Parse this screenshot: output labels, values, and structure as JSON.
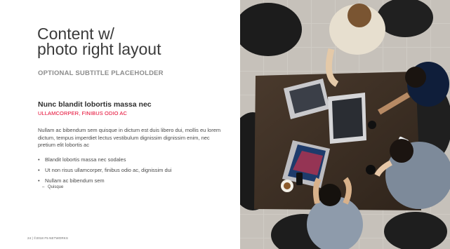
{
  "title": "Content w/\nphoto right layout",
  "subtitle": "OPTIONAL SUBTITLE PLACEHOLDER",
  "heading": "Nunc blandit lobortis massa nec",
  "subheading": "ULLAMCORPER, FINIBUS ODIO AC",
  "paragraph": "Nullam ac bibendum sem quisque in dictum est duis libero dui, mollis eu lorem dictum, tempus imperdiet lectus vestibulum dignissim dignissim enim, nec pretium elit lobortis ac",
  "bullets": [
    {
      "text": "Blandit lobortis massa nec sodales"
    },
    {
      "text": "Ut non risus ullamcorper, finibus odio ac, dignissim dui"
    },
    {
      "text": "Nullam ac bibendum sem"
    }
  ],
  "sub_bullet": "Quisque",
  "bullet_char": "•",
  "sub_bullet_char": "–",
  "footer": "24 | ©2018 F5 NETWORKS",
  "colors": {
    "accent": "#e4002b",
    "title": "#3b3b3b",
    "subtitle": "#8c8c8c",
    "body": "#4a4a4a"
  },
  "photo": {
    "description_icon": "office-meeting-photo"
  }
}
